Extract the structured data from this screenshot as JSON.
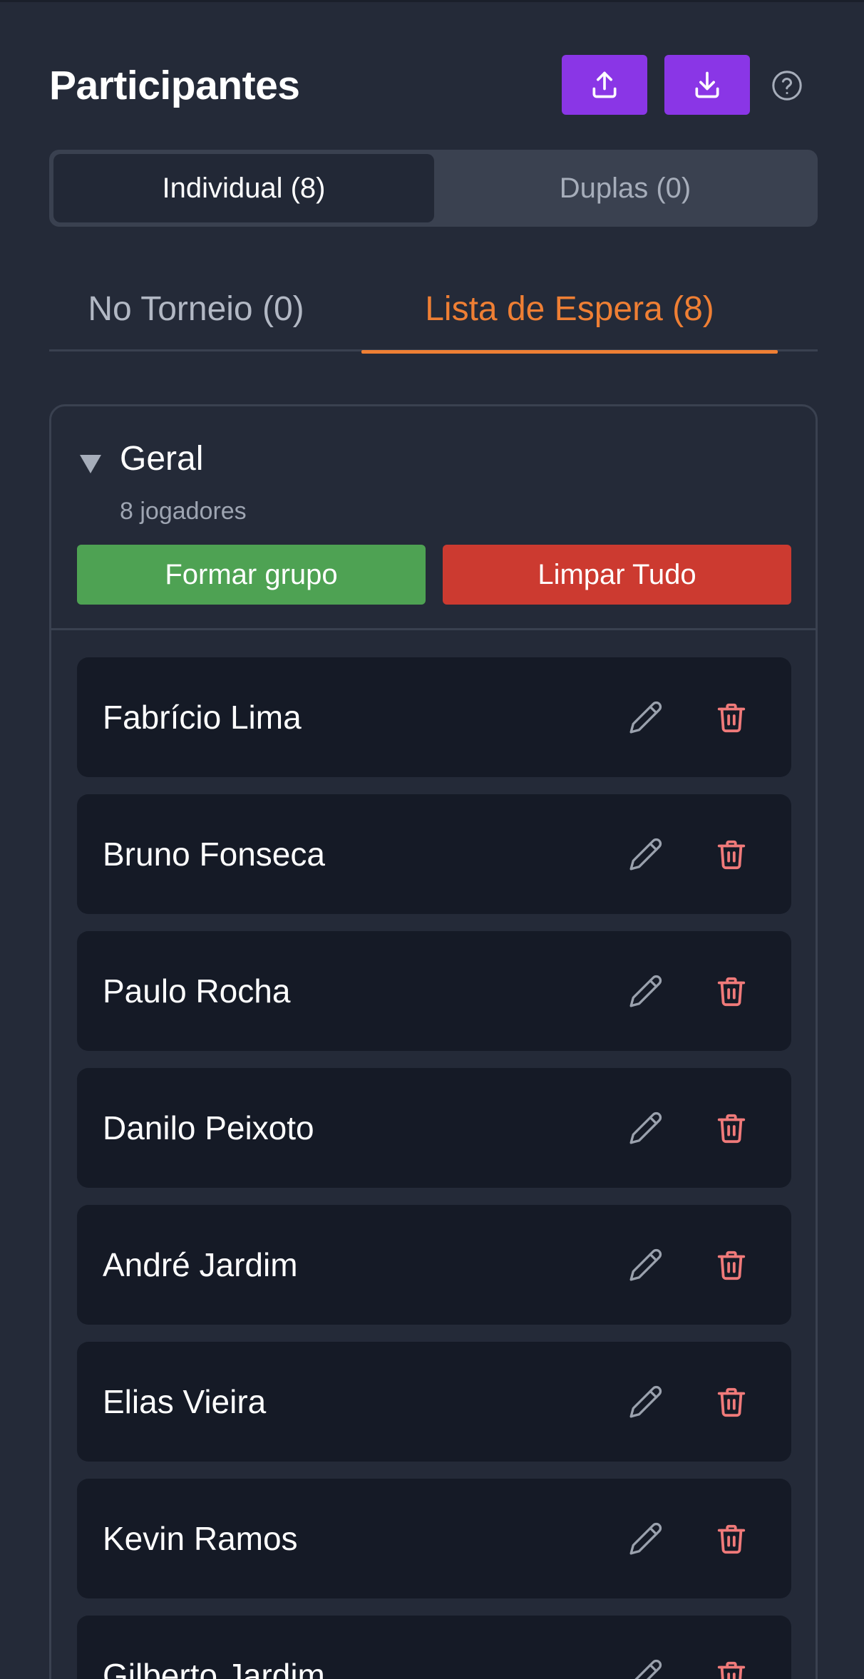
{
  "header": {
    "title": "Participantes",
    "upload_icon": "upload-icon",
    "download_icon": "download-icon",
    "help_icon": "help-circle-icon"
  },
  "segmented": {
    "individual": "Individual (8)",
    "duplas": "Duplas (0)"
  },
  "tabs": {
    "in_tournament": "No Torneio (0)",
    "waiting_list": "Lista de Espera (8)"
  },
  "group": {
    "name": "Geral",
    "count": "8 jogadores",
    "form_button": "Formar grupo",
    "clear_button": "Limpar Tudo"
  },
  "players": [
    {
      "name": "Fabrício Lima"
    },
    {
      "name": "Bruno Fonseca"
    },
    {
      "name": "Paulo Rocha"
    },
    {
      "name": "Danilo Peixoto"
    },
    {
      "name": "André Jardim"
    },
    {
      "name": "Elias Vieira"
    },
    {
      "name": "Kevin Ramos"
    },
    {
      "name": "Gilberto Jardim"
    }
  ],
  "colors": {
    "accent": "#8a36e6",
    "active_tab": "#ef7f34",
    "form_button": "#4ea253",
    "clear_button": "#cc3a30",
    "delete_icon": "#f07a7a"
  }
}
